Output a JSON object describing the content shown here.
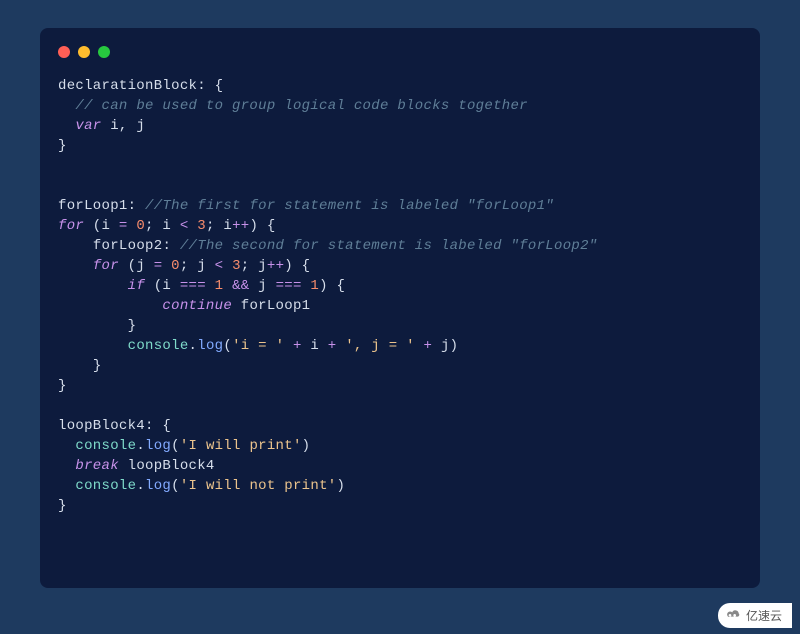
{
  "tokens": {
    "l1_label": "declarationBlock",
    "l1_colon": ": ",
    "l1_brace": "{",
    "l2_indent": "  ",
    "l2_comment": "// can be used to group logical code blocks together",
    "l3_indent": "  ",
    "l3_kw": "var",
    "l3_vars": " i, j",
    "l4_brace": "}",
    "l7_label": "forLoop1",
    "l7_colon": ": ",
    "l7_comment": "//The first for statement is labeled \"forLoop1\"",
    "l8_kw": "for",
    "l8_open": " (i ",
    "l8_op1": "=",
    "l8_sp1": " ",
    "l8_n1": "0",
    "l8_semi1": "; i ",
    "l8_op2": "<",
    "l8_sp2": " ",
    "l8_n2": "3",
    "l8_semi2": "; i",
    "l8_op3": "++",
    "l8_close": ") {",
    "l9_indent": "    ",
    "l9_label": "forLoop2",
    "l9_colon": ": ",
    "l9_comment": "//The second for statement is labeled \"forLoop2\"",
    "l10_indent": "    ",
    "l10_kw": "for",
    "l10_open": " (j ",
    "l10_op1": "=",
    "l10_sp1": " ",
    "l10_n1": "0",
    "l10_semi1": "; j ",
    "l10_op2": "<",
    "l10_sp2": " ",
    "l10_n2": "3",
    "l10_semi2": "; j",
    "l10_op3": "++",
    "l10_close": ") {",
    "l11_indent": "        ",
    "l11_kw": "if",
    "l11_open": " (i ",
    "l11_op1": "===",
    "l11_sp1": " ",
    "l11_n1": "1",
    "l11_sp2": " ",
    "l11_op2": "&&",
    "l11_sp3": " j ",
    "l11_op3": "===",
    "l11_sp4": " ",
    "l11_n2": "1",
    "l11_close": ") {",
    "l12_indent": "            ",
    "l12_kw": "continue",
    "l12_target": " forLoop1",
    "l13_indent": "        ",
    "l13_brace": "}",
    "l14_indent": "        ",
    "l14_obj": "console",
    "l14_dot": ".",
    "l14_call": "log",
    "l14_open": "(",
    "l14_str1": "'i = '",
    "l14_op1": " + ",
    "l14_var1": "i",
    "l14_op2": " + ",
    "l14_str2": "', j = '",
    "l14_op3": " + ",
    "l14_var2": "j",
    "l14_close": ")",
    "l15_indent": "    ",
    "l15_brace": "}",
    "l16_brace": "}",
    "l18_label": "loopBlock4",
    "l18_colon": ": ",
    "l18_brace": "{",
    "l19_indent": "  ",
    "l19_obj": "console",
    "l19_dot": ".",
    "l19_call": "log",
    "l19_open": "(",
    "l19_str": "'I will print'",
    "l19_close": ")",
    "l20_indent": "  ",
    "l20_kw": "break",
    "l20_target": " loopBlock4",
    "l21_indent": "  ",
    "l21_obj": "console",
    "l21_dot": ".",
    "l21_call": "log",
    "l21_open": "(",
    "l21_str": "'I will not print'",
    "l21_close": ")",
    "l22_brace": "}"
  },
  "watermark": {
    "text": "亿速云"
  }
}
